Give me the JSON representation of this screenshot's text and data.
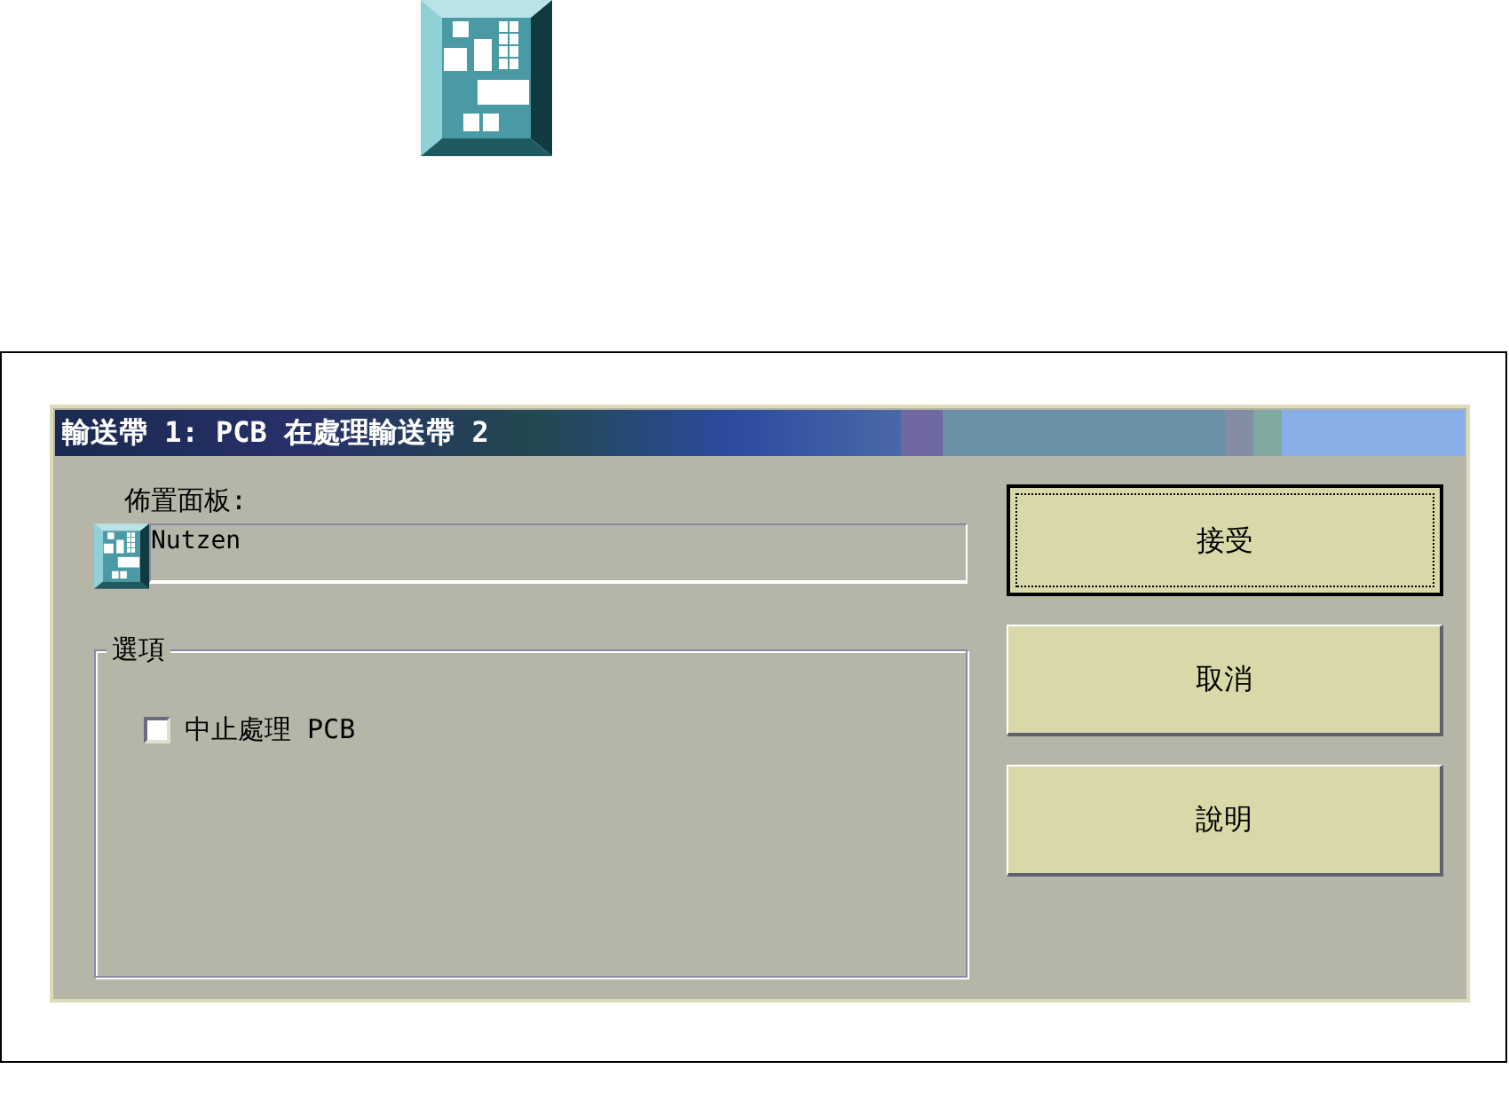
{
  "window": {
    "title": "輸送帶 1: PCB 在處理輸送帶 2"
  },
  "layout_panel": {
    "label": "佈置面板:",
    "value": "Nutzen"
  },
  "options": {
    "label": "選項",
    "items": [
      {
        "label": "中止處理 PCB",
        "checked": false
      }
    ]
  },
  "buttons": [
    {
      "label": "接受",
      "default": true
    },
    {
      "label": "取消",
      "default": false
    },
    {
      "label": "說明",
      "default": false
    }
  ]
}
